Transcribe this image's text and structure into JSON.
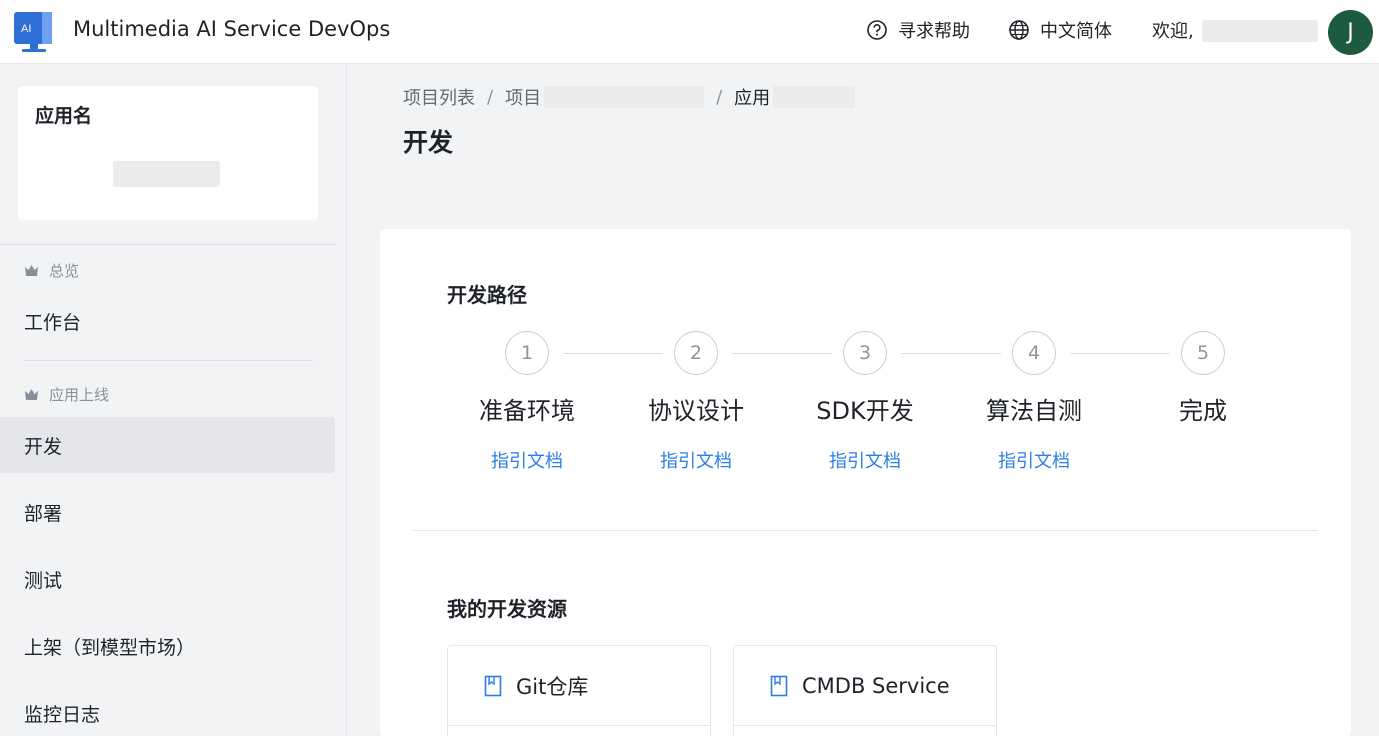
{
  "header": {
    "logo_text": "AI",
    "title": "Multimedia AI Service DevOps",
    "help_label": "寻求帮助",
    "lang_label": "中文简体",
    "welcome_label": "欢迎,",
    "avatar_initial": "J",
    "avatar_color": "#1d5b40"
  },
  "sidebar": {
    "app_card_label": "应用名",
    "groups": [
      {
        "label": "总览",
        "items": [
          "工作台"
        ]
      },
      {
        "label": "应用上线",
        "items": [
          "开发",
          "部署",
          "测试",
          "上架（到模型市场）",
          "监控日志"
        ]
      }
    ],
    "active_item": "开发"
  },
  "breadcrumb": {
    "items": [
      "项目列表",
      "项目",
      "应用"
    ],
    "separator": "/"
  },
  "page_title": "开发",
  "dev_path": {
    "title": "开发路径",
    "steps": [
      {
        "number": "1",
        "title": "准备环境",
        "link": "指引文档"
      },
      {
        "number": "2",
        "title": "协议设计",
        "link": "指引文档"
      },
      {
        "number": "3",
        "title": "SDK开发",
        "link": "指引文档"
      },
      {
        "number": "4",
        "title": "算法自测",
        "link": "指引文档"
      },
      {
        "number": "5",
        "title": "完成"
      }
    ]
  },
  "resources": {
    "title": "我的开发资源",
    "items": [
      {
        "label": "Git仓库",
        "icon": "book-icon"
      },
      {
        "label": "CMDB Service",
        "icon": "book-icon"
      }
    ]
  },
  "colors": {
    "link": "#2b7de9",
    "accent_logo": "#2f6fd6"
  }
}
